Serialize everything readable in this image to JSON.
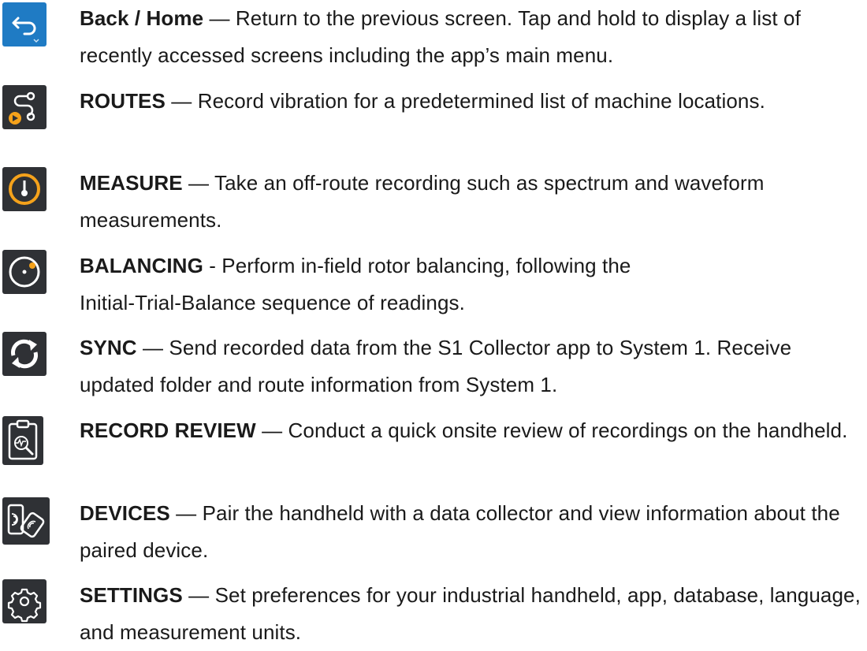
{
  "items": [
    {
      "id": "back-home",
      "icon": "back-arrow-icon",
      "name": "Back / Home",
      "sep": " — ",
      "desc": "Return to the previous screen. Tap and hold to display a list of recently accessed screens including the app’s main menu."
    },
    {
      "id": "routes",
      "icon": "routes-icon",
      "name": "ROUTES",
      "sep": " — ",
      "desc": "Record vibration for a predetermined list of machine locations."
    },
    {
      "id": "measure",
      "icon": "measure-gauge-icon",
      "name": "MEASURE",
      "sep": " — ",
      "desc": "Take an off-route recording such as spectrum and waveform measurements."
    },
    {
      "id": "balancing",
      "icon": "balancing-icon",
      "name": "BALANCING",
      "sep": " - ",
      "desc": "Perform in-field rotor balancing, following the",
      "desc2": "Initial-Trial-Balance sequence of readings."
    },
    {
      "id": "sync",
      "icon": "sync-icon",
      "name": "SYNC",
      "sep": " — ",
      "desc": "Send recorded data from the S1 Collector app to System 1. Receive updated folder and route information from System 1."
    },
    {
      "id": "record-review",
      "icon": "record-review-icon",
      "name": "RECORD REVIEW",
      "sep": " — ",
      "desc": "Conduct a quick onsite review of recordings on the handheld."
    },
    {
      "id": "devices",
      "icon": "devices-icon",
      "name": "DEVICES",
      "sep": " — ",
      "desc": "Pair the handheld with a data collector and view information about the paired device."
    },
    {
      "id": "settings",
      "icon": "settings-gear-icon",
      "name": "SETTINGS",
      "sep": " — ",
      "desc": "Set preferences for your industrial handheld, app, database, language, and measurement units."
    }
  ],
  "colors": {
    "accent_blue": "#1f7bc4",
    "accent_orange": "#f5a21b",
    "icon_bg": "#2f3135",
    "text": "#1a1a1a"
  }
}
